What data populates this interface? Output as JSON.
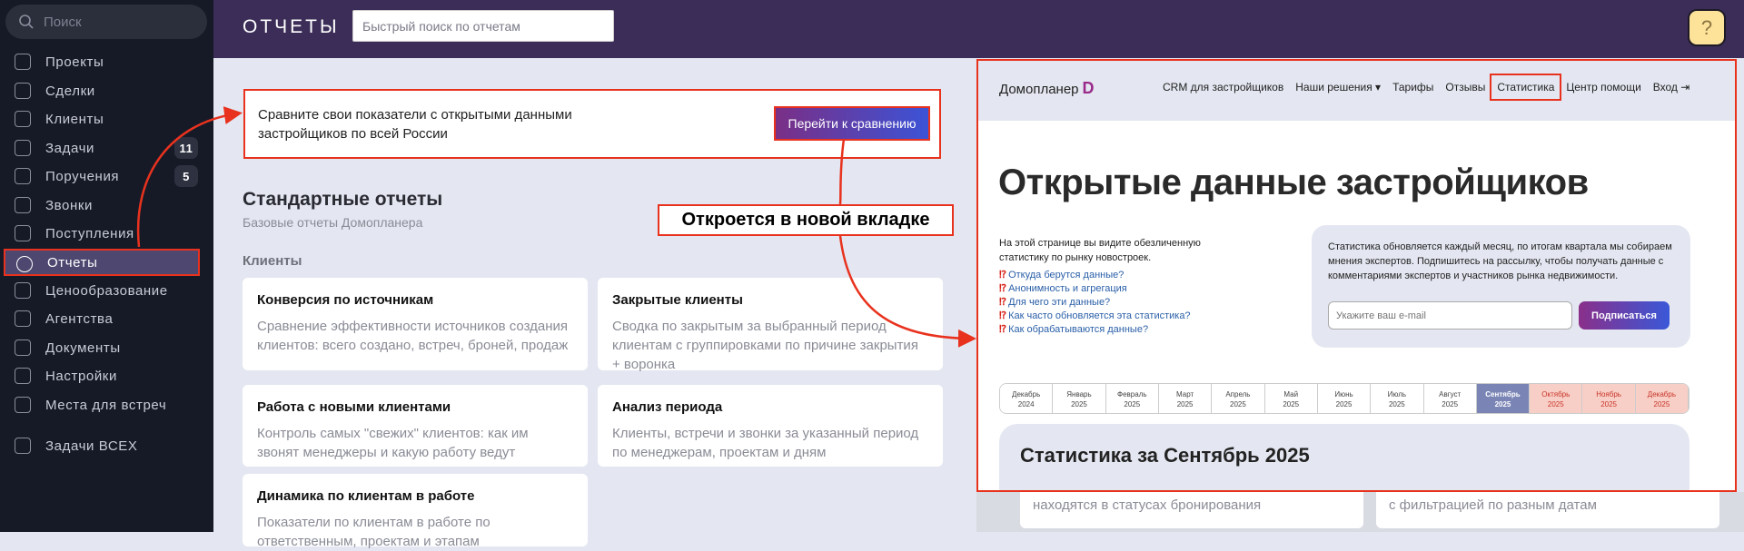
{
  "sidebar": {
    "search_placeholder": "Поиск",
    "items": [
      {
        "label": "Проекты",
        "icon": "projects-icon"
      },
      {
        "label": "Сделки",
        "icon": "deals-icon"
      },
      {
        "label": "Клиенты",
        "icon": "clients-icon"
      },
      {
        "label": "Задачи",
        "icon": "tasks-icon",
        "badge": "11"
      },
      {
        "label": "Поручения",
        "icon": "assignments-icon",
        "badge": "5"
      },
      {
        "label": "Звонки",
        "icon": "calls-icon"
      },
      {
        "label": "Поступления",
        "icon": "payments-icon"
      },
      {
        "label": "Отчеты",
        "icon": "reports-icon",
        "active": true
      },
      {
        "label": "Ценообразование",
        "icon": "pricing-icon"
      },
      {
        "label": "Агентства",
        "icon": "agencies-icon"
      },
      {
        "label": "Документы",
        "icon": "documents-icon"
      },
      {
        "label": "Настройки",
        "icon": "settings-icon"
      },
      {
        "label": "Места для встреч",
        "icon": "meeting-places-icon"
      },
      {
        "label": "Задачи ВСЕХ",
        "icon": "all-tasks-icon"
      }
    ]
  },
  "header": {
    "title": "ОТЧЕТЫ",
    "search_placeholder": "Быстрый поиск по отчетам",
    "help": "?"
  },
  "banner": {
    "text": "Сравните свои показатели с открытыми данными застройщиков по всей России",
    "button": "Перейти к сравнению"
  },
  "reports": {
    "title": "Стандартные отчеты",
    "subtitle": "Базовые отчеты Домопланера",
    "group": "Клиенты",
    "cards": [
      {
        "title": "Конверсия по источникам",
        "desc": "Сравнение эффективности источников создания клиентов: всего создано, встреч, броней, продаж"
      },
      {
        "title": "Закрытые клиенты",
        "desc": "Сводка по закрытым за выбранный период клиентам с группировками по причине закрытия + воронка"
      },
      {
        "title": "Работа с новыми клиентами",
        "desc": "Контроль самых \"свежих\" клиентов: как им звонят менеджеры и какую работу ведут"
      },
      {
        "title": "Анализ периода",
        "desc": "Клиенты, встречи и звонки за указанный период по менеджерам, проектам и дням"
      },
      {
        "title": "Динамика по клиентам в работе",
        "desc": "Показатели по клиентам в работе по ответственным, проектам и этапам"
      }
    ]
  },
  "annotation": "Откроется в новой вкладке",
  "external": {
    "logo": "Домопланер",
    "logo_mark": "D",
    "nav": [
      "CRM для застройщиков",
      "Наши решения ▾",
      "Тарифы",
      "Отзывы",
      "Статистика",
      "Центр помощи",
      "Вход ⇥"
    ],
    "heading": "Открытые данные застройщиков",
    "intro": "На этой странице вы видите обезличенную статистику по рынку новостроек.",
    "links": [
      "Откуда берутся данные?",
      "Анонимность и агрегация",
      "Для чего эти данные?",
      "Как часто обновляется эта статистика?",
      "Как обрабатываются данные?"
    ],
    "subscribe_text": "Статистика обновляется каждый месяц, по итогам квартала мы собираем мнения экспертов. Подпишитесь на рассылку, чтобы получать данные с комментариями экспертов и участников рынка недвижимости.",
    "email_placeholder": "Укажите ваш e-mail",
    "subscribe_button": "Подписаться",
    "months": [
      {
        "m": "Декабрь",
        "y": "2024"
      },
      {
        "m": "Январь",
        "y": "2025"
      },
      {
        "m": "Февраль",
        "y": "2025"
      },
      {
        "m": "Март",
        "y": "2025"
      },
      {
        "m": "Апрель",
        "y": "2025"
      },
      {
        "m": "Май",
        "y": "2025"
      },
      {
        "m": "Июнь",
        "y": "2025"
      },
      {
        "m": "Июль",
        "y": "2025"
      },
      {
        "m": "Август",
        "y": "2025"
      },
      {
        "m": "Сентябрь",
        "y": "2025",
        "state": "cur"
      },
      {
        "m": "Октябрь",
        "y": "2025",
        "state": "fut"
      },
      {
        "m": "Ноябрь",
        "y": "2025",
        "state": "fut"
      },
      {
        "m": "Декабрь",
        "y": "2025",
        "state": "fut"
      }
    ],
    "stats_title": "Статистика за Сентябрь 2025",
    "below_cards": [
      "находятся в статусах бронирования",
      "с фильтрацией по разным датам"
    ]
  },
  "colors": {
    "accent": "#e8321e",
    "header": "#3b2d57",
    "sidebar": "#161a27"
  }
}
